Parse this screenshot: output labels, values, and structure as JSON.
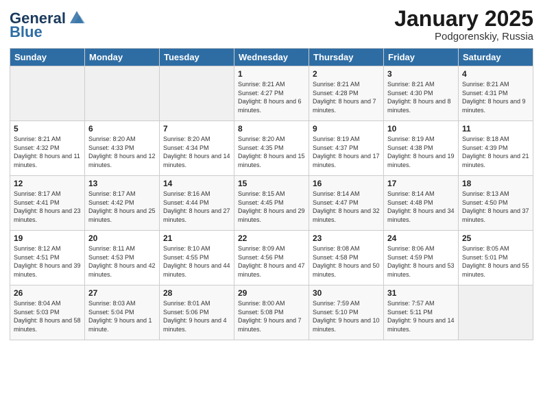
{
  "header": {
    "logo_general": "General",
    "logo_blue": "Blue",
    "month": "January 2025",
    "location": "Podgorenskiy, Russia"
  },
  "weekdays": [
    "Sunday",
    "Monday",
    "Tuesday",
    "Wednesday",
    "Thursday",
    "Friday",
    "Saturday"
  ],
  "weeks": [
    [
      {
        "day": "",
        "sunrise": "",
        "sunset": "",
        "daylight": ""
      },
      {
        "day": "",
        "sunrise": "",
        "sunset": "",
        "daylight": ""
      },
      {
        "day": "",
        "sunrise": "",
        "sunset": "",
        "daylight": ""
      },
      {
        "day": "1",
        "sunrise": "Sunrise: 8:21 AM",
        "sunset": "Sunset: 4:27 PM",
        "daylight": "Daylight: 8 hours and 6 minutes."
      },
      {
        "day": "2",
        "sunrise": "Sunrise: 8:21 AM",
        "sunset": "Sunset: 4:28 PM",
        "daylight": "Daylight: 8 hours and 7 minutes."
      },
      {
        "day": "3",
        "sunrise": "Sunrise: 8:21 AM",
        "sunset": "Sunset: 4:30 PM",
        "daylight": "Daylight: 8 hours and 8 minutes."
      },
      {
        "day": "4",
        "sunrise": "Sunrise: 8:21 AM",
        "sunset": "Sunset: 4:31 PM",
        "daylight": "Daylight: 8 hours and 9 minutes."
      }
    ],
    [
      {
        "day": "5",
        "sunrise": "Sunrise: 8:21 AM",
        "sunset": "Sunset: 4:32 PM",
        "daylight": "Daylight: 8 hours and 11 minutes."
      },
      {
        "day": "6",
        "sunrise": "Sunrise: 8:20 AM",
        "sunset": "Sunset: 4:33 PM",
        "daylight": "Daylight: 8 hours and 12 minutes."
      },
      {
        "day": "7",
        "sunrise": "Sunrise: 8:20 AM",
        "sunset": "Sunset: 4:34 PM",
        "daylight": "Daylight: 8 hours and 14 minutes."
      },
      {
        "day": "8",
        "sunrise": "Sunrise: 8:20 AM",
        "sunset": "Sunset: 4:35 PM",
        "daylight": "Daylight: 8 hours and 15 minutes."
      },
      {
        "day": "9",
        "sunrise": "Sunrise: 8:19 AM",
        "sunset": "Sunset: 4:37 PM",
        "daylight": "Daylight: 8 hours and 17 minutes."
      },
      {
        "day": "10",
        "sunrise": "Sunrise: 8:19 AM",
        "sunset": "Sunset: 4:38 PM",
        "daylight": "Daylight: 8 hours and 19 minutes."
      },
      {
        "day": "11",
        "sunrise": "Sunrise: 8:18 AM",
        "sunset": "Sunset: 4:39 PM",
        "daylight": "Daylight: 8 hours and 21 minutes."
      }
    ],
    [
      {
        "day": "12",
        "sunrise": "Sunrise: 8:17 AM",
        "sunset": "Sunset: 4:41 PM",
        "daylight": "Daylight: 8 hours and 23 minutes."
      },
      {
        "day": "13",
        "sunrise": "Sunrise: 8:17 AM",
        "sunset": "Sunset: 4:42 PM",
        "daylight": "Daylight: 8 hours and 25 minutes."
      },
      {
        "day": "14",
        "sunrise": "Sunrise: 8:16 AM",
        "sunset": "Sunset: 4:44 PM",
        "daylight": "Daylight: 8 hours and 27 minutes."
      },
      {
        "day": "15",
        "sunrise": "Sunrise: 8:15 AM",
        "sunset": "Sunset: 4:45 PM",
        "daylight": "Daylight: 8 hours and 29 minutes."
      },
      {
        "day": "16",
        "sunrise": "Sunrise: 8:14 AM",
        "sunset": "Sunset: 4:47 PM",
        "daylight": "Daylight: 8 hours and 32 minutes."
      },
      {
        "day": "17",
        "sunrise": "Sunrise: 8:14 AM",
        "sunset": "Sunset: 4:48 PM",
        "daylight": "Daylight: 8 hours and 34 minutes."
      },
      {
        "day": "18",
        "sunrise": "Sunrise: 8:13 AM",
        "sunset": "Sunset: 4:50 PM",
        "daylight": "Daylight: 8 hours and 37 minutes."
      }
    ],
    [
      {
        "day": "19",
        "sunrise": "Sunrise: 8:12 AM",
        "sunset": "Sunset: 4:51 PM",
        "daylight": "Daylight: 8 hours and 39 minutes."
      },
      {
        "day": "20",
        "sunrise": "Sunrise: 8:11 AM",
        "sunset": "Sunset: 4:53 PM",
        "daylight": "Daylight: 8 hours and 42 minutes."
      },
      {
        "day": "21",
        "sunrise": "Sunrise: 8:10 AM",
        "sunset": "Sunset: 4:55 PM",
        "daylight": "Daylight: 8 hours and 44 minutes."
      },
      {
        "day": "22",
        "sunrise": "Sunrise: 8:09 AM",
        "sunset": "Sunset: 4:56 PM",
        "daylight": "Daylight: 8 hours and 47 minutes."
      },
      {
        "day": "23",
        "sunrise": "Sunrise: 8:08 AM",
        "sunset": "Sunset: 4:58 PM",
        "daylight": "Daylight: 8 hours and 50 minutes."
      },
      {
        "day": "24",
        "sunrise": "Sunrise: 8:06 AM",
        "sunset": "Sunset: 4:59 PM",
        "daylight": "Daylight: 8 hours and 53 minutes."
      },
      {
        "day": "25",
        "sunrise": "Sunrise: 8:05 AM",
        "sunset": "Sunset: 5:01 PM",
        "daylight": "Daylight: 8 hours and 55 minutes."
      }
    ],
    [
      {
        "day": "26",
        "sunrise": "Sunrise: 8:04 AM",
        "sunset": "Sunset: 5:03 PM",
        "daylight": "Daylight: 8 hours and 58 minutes."
      },
      {
        "day": "27",
        "sunrise": "Sunrise: 8:03 AM",
        "sunset": "Sunset: 5:04 PM",
        "daylight": "Daylight: 9 hours and 1 minute."
      },
      {
        "day": "28",
        "sunrise": "Sunrise: 8:01 AM",
        "sunset": "Sunset: 5:06 PM",
        "daylight": "Daylight: 9 hours and 4 minutes."
      },
      {
        "day": "29",
        "sunrise": "Sunrise: 8:00 AM",
        "sunset": "Sunset: 5:08 PM",
        "daylight": "Daylight: 9 hours and 7 minutes."
      },
      {
        "day": "30",
        "sunrise": "Sunrise: 7:59 AM",
        "sunset": "Sunset: 5:10 PM",
        "daylight": "Daylight: 9 hours and 10 minutes."
      },
      {
        "day": "31",
        "sunrise": "Sunrise: 7:57 AM",
        "sunset": "Sunset: 5:11 PM",
        "daylight": "Daylight: 9 hours and 14 minutes."
      },
      {
        "day": "",
        "sunrise": "",
        "sunset": "",
        "daylight": ""
      }
    ]
  ]
}
